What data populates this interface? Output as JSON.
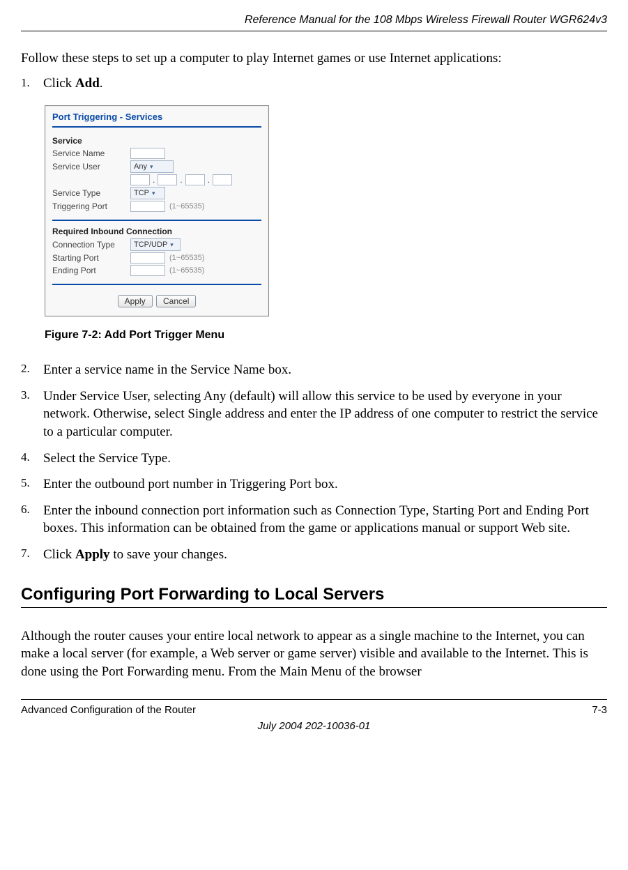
{
  "header": {
    "running_title": "Reference Manual for the 108 Mbps Wireless Firewall Router WGR624v3"
  },
  "intro": "Follow these steps to set up a computer to play Internet games or use Internet applications:",
  "step1_prefix": "Click ",
  "step1_bold": "Add",
  "step1_suffix": ".",
  "figure": {
    "panel_title": "Port Triggering - Services",
    "service_heading": "Service",
    "labels": {
      "service_name": "Service Name",
      "service_user": "Service User",
      "service_type": "Service Type",
      "triggering_port": "Triggering Port",
      "inbound_heading": "Required Inbound Connection",
      "connection_type": "Connection Type",
      "starting_port": "Starting Port",
      "ending_port": "Ending Port"
    },
    "values": {
      "service_user_select": "Any",
      "service_type_select": "TCP",
      "connection_type_select": "TCP/UDP",
      "range_hint": "(1~65535)"
    },
    "buttons": {
      "apply": "Apply",
      "cancel": "Cancel"
    },
    "caption": "Figure 7-2:  Add Port Trigger Menu"
  },
  "steps2": {
    "s2": "Enter a service name in the Service Name box.",
    "s3": "Under Service User, selecting Any (default) will allow this service to be used by everyone in your network. Otherwise, select Single address and enter the IP address of one computer to restrict the service to a particular computer.",
    "s4": "Select the Service Type.",
    "s5": "Enter the outbound port number in Triggering Port box.",
    "s6": "Enter the inbound connection port information such as Connection Type, Starting Port and Ending Port boxes. This information can be obtained from the game or applications manual or support Web site.",
    "s7_prefix": "Click ",
    "s7_bold": "Apply",
    "s7_suffix": " to save your changes."
  },
  "section_title": "Configuring Port Forwarding to Local Servers",
  "section_body": "Although the router causes your entire local network to appear as a single machine to the Internet, you can make a local server (for example, a Web server or game server) visible and available to the Internet. This is done using the Port Forwarding menu. From the Main Menu of the browser",
  "footer": {
    "left": "Advanced Configuration of the Router",
    "right": "7-3",
    "center": "July 2004 202-10036-01"
  }
}
